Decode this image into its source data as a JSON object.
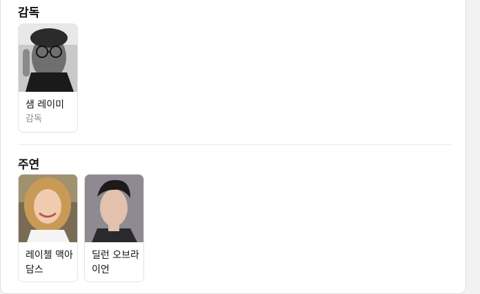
{
  "director_section": {
    "title": "감독",
    "people": [
      {
        "name": "샘 레이미",
        "role": "감독",
        "photo_icon": "person-photo-icon"
      }
    ]
  },
  "cast_section": {
    "title": "주연",
    "people": [
      {
        "name": "레이첼 맥아담스",
        "photo_icon": "person-photo-icon"
      },
      {
        "name": "딜런 오브라이언",
        "photo_icon": "person-photo-icon"
      }
    ]
  }
}
